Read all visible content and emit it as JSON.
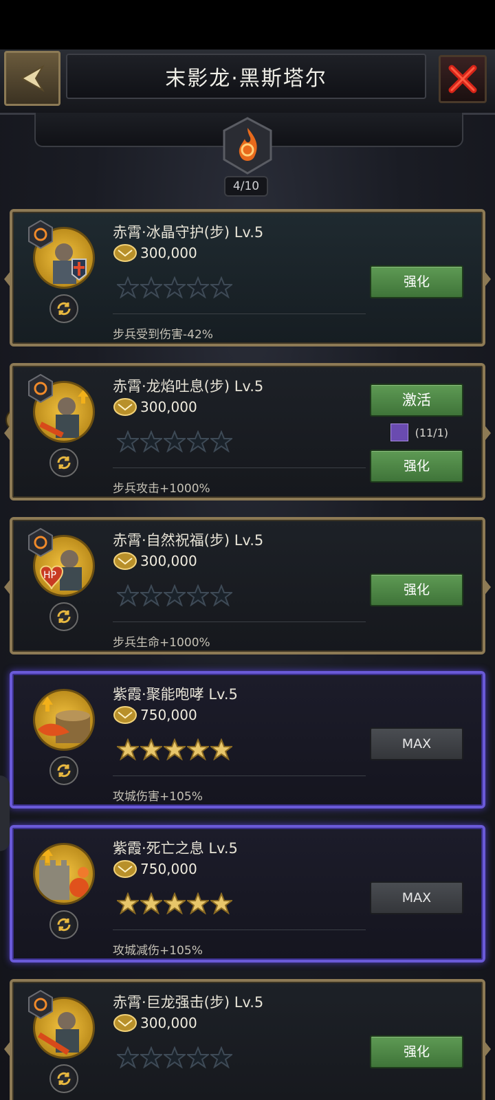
{
  "header": {
    "title": "末影龙·黑斯塔尔"
  },
  "progress": {
    "label": "4/10"
  },
  "cards": [
    {
      "name": "赤霄·冰晶守护(步) Lv.5",
      "cost": "300,000",
      "stars_filled": 0,
      "effect": "步兵受到伤害-42%",
      "button": "强化",
      "tier": "red"
    },
    {
      "name": "赤霄·龙焰吐息(步) Lv.5",
      "cost": "300,000",
      "stars_filled": 0,
      "effect": "步兵攻击+1000%",
      "button": "强化",
      "activate": "激活",
      "requirement": "(11/1)",
      "tier": "red"
    },
    {
      "name": "赤霄·自然祝福(步) Lv.5",
      "cost": "300,000",
      "stars_filled": 0,
      "effect": "步兵生命+1000%",
      "button": "强化",
      "tier": "red"
    },
    {
      "name": "紫霞·聚能咆哮 Lv.5",
      "cost": "750,000",
      "stars_filled": 5,
      "effect": "攻城伤害+105%",
      "button": "MAX",
      "tier": "purple"
    },
    {
      "name": "紫霞·死亡之息 Lv.5",
      "cost": "750,000",
      "stars_filled": 5,
      "effect": "攻城减伤+105%",
      "button": "MAX",
      "tier": "purple"
    },
    {
      "name": "赤霄·巨龙强击(步) Lv.5",
      "cost": "300,000",
      "stars_filled": 0,
      "effect": "",
      "button": "强化",
      "tier": "red"
    }
  ],
  "alert_icon": "!",
  "colors": {
    "gold_border": "#8d7a55",
    "purple_border": "#6a5ad8",
    "green_button": "#4f8a47",
    "gray_button": "#404348"
  }
}
